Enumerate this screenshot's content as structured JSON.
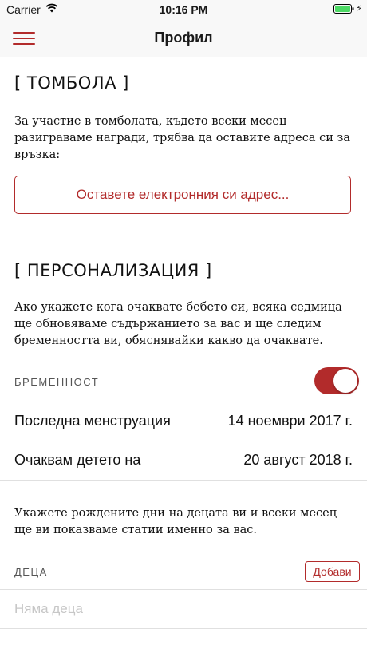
{
  "status_bar": {
    "carrier": "Carrier",
    "time": "10:16 PM"
  },
  "nav": {
    "title": "Профил"
  },
  "raffle": {
    "title": "[ ТОМБОЛА ]",
    "text_lines": [
      "За участие в томболата, където всеки месец",
      "разиграваме награди, трябва да оставите адреса си за",
      "връзка:"
    ],
    "email_button_label": "Оставете електронния си адрес..."
  },
  "personalization": {
    "title": "[ ПЕРСОНАЛИЗАЦИЯ ]",
    "text_lines": [
      "Ако укажете кога очаквате бебето си, всяка седмица",
      "ще обновяваме съдържанието за вас и ще следим",
      "бременността ви, обяснявайки какво да очаквате."
    ],
    "pregnancy_label": "БРЕМЕННОСТ",
    "pregnancy_on": true,
    "rows": [
      {
        "label": "Последна менструация",
        "value": "14 ноември 2017 г."
      },
      {
        "label": "Очаквам детето на",
        "value": "20 август 2018 г."
      }
    ]
  },
  "children": {
    "text_lines": [
      "Укажете рождените дни на децата ви и всеки месец",
      "ще ви показваме статии именно за вас."
    ],
    "header": "ДЕЦА",
    "add_button_label": "Добави",
    "empty_text": "Няма деца"
  },
  "colors": {
    "accent": "#b22b2b",
    "battery": "#4cd964"
  },
  "icons": [
    "wifi-icon",
    "battery-icon",
    "charging-bolt-icon",
    "hamburger-menu-icon"
  ]
}
